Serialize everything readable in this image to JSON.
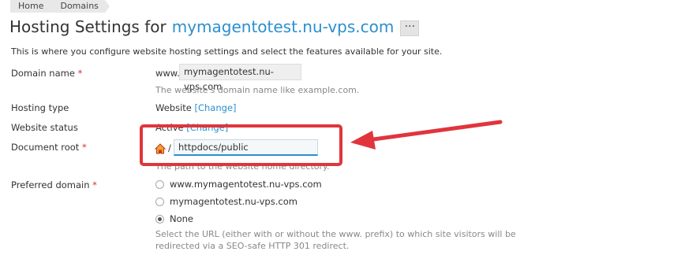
{
  "breadcrumb": {
    "home": "Home",
    "domains": "Domains"
  },
  "header": {
    "title_prefix": "Hosting Settings for",
    "domain": "mymagentotest.nu-vps.com",
    "more": "···"
  },
  "intro": "This is where you configure website hosting settings and select the features available for your site.",
  "fields": {
    "domain_name": {
      "label": "Domain name",
      "required": "*",
      "prefix": "www.",
      "value": "mymagentotest.nu-vps.com",
      "hint": "The website's domain name like example.com."
    },
    "hosting_type": {
      "label": "Hosting type",
      "value": "Website",
      "change": "[Change]"
    },
    "website_status": {
      "label": "Website status",
      "value": "Active",
      "change": "[Change]"
    },
    "document_root": {
      "label": "Document root",
      "required": "*",
      "separator": "/",
      "value": "httpdocs/public",
      "hint": "The path to the website home directory."
    },
    "preferred_domain": {
      "label": "Preferred domain",
      "required": "*",
      "options": [
        "www.mymagentotest.nu-vps.com",
        "mymagentotest.nu-vps.com",
        "None"
      ],
      "selected": "None",
      "hint_line1": "Select the URL (either with or without the www. prefix) to which site visitors will be",
      "hint_line2": "redirected via a SEO-safe HTTP 301 redirect."
    }
  },
  "colors": {
    "accent": "#2b8fce",
    "required": "#d4322f",
    "annotation": "#e0353c"
  },
  "icons": {
    "home": "home-icon",
    "annotation_arrow": "arrow-icon"
  }
}
